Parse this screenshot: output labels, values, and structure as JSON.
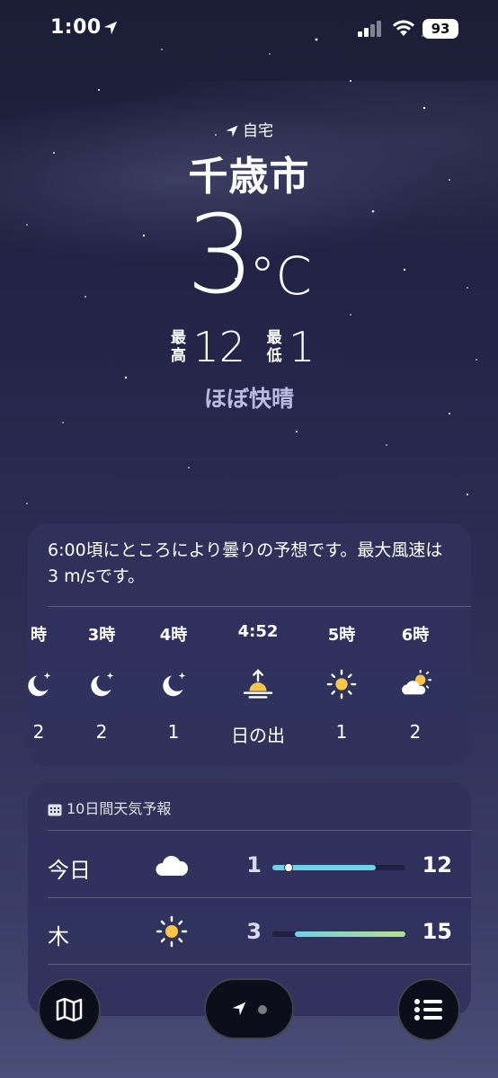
{
  "status_bar": {
    "time": "1:00",
    "battery": "93"
  },
  "location": {
    "home_label": "自宅",
    "city": "千歳市",
    "temperature": "3",
    "unit": "°C",
    "high_label": "最高",
    "high": "12",
    "low_label": "最低",
    "low": "1",
    "condition": "ほぼ快晴"
  },
  "hourly": {
    "summary": "6:00頃にところにより曇りの予想です。最大風速は3 m/sです。",
    "items": [
      {
        "label": "時",
        "icon": "moon-stars-icon",
        "value": "2"
      },
      {
        "label": "3時",
        "icon": "moon-stars-icon",
        "value": "2"
      },
      {
        "label": "4時",
        "icon": "moon-stars-icon",
        "value": "1"
      },
      {
        "label": "4:52",
        "icon": "sunrise-icon",
        "value": "日の出"
      },
      {
        "label": "5時",
        "icon": "sun-icon",
        "value": "1"
      },
      {
        "label": "6時",
        "icon": "partly-cloudy-icon",
        "value": "2"
      }
    ]
  },
  "daily": {
    "title": "10日間天気予報",
    "days": [
      {
        "name": "今日",
        "icon": "cloud-icon",
        "low": "1",
        "high": "12",
        "range_start": 0.0,
        "range_end": 0.78,
        "current": 0.12
      },
      {
        "name": "木",
        "icon": "sun-icon",
        "low": "3",
        "high": "15",
        "range_start": 0.17,
        "range_end": 1.0
      }
    ]
  },
  "colors": {
    "accent_range_blue": "#6fd0e6",
    "accent_range_green": "#b8e08a",
    "condition_text": "#b8bce2"
  }
}
